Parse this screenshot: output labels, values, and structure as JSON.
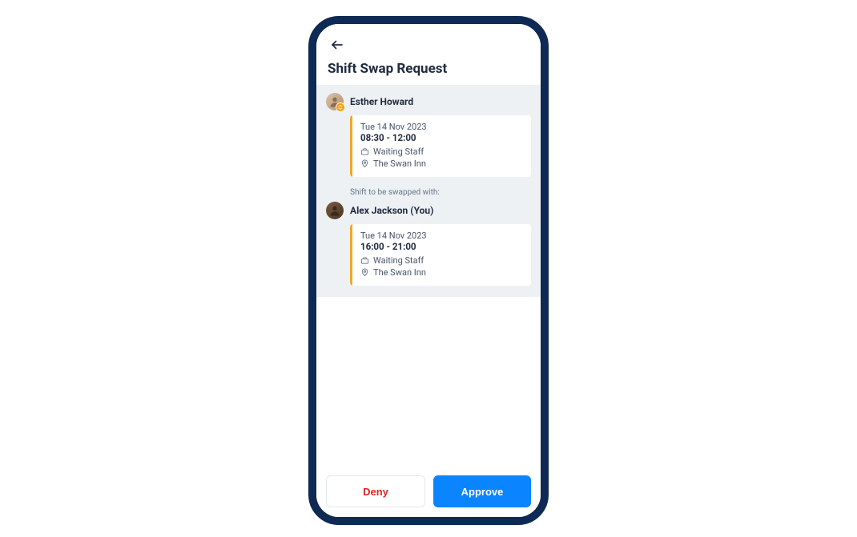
{
  "header": {
    "title": "Shift Swap Request"
  },
  "requester": {
    "name": "Esther Howard",
    "shift": {
      "date": "Tue 14 Nov 2023",
      "time": "08:30 - 12:00",
      "role": "Waiting Staff",
      "location": "The Swan Inn"
    }
  },
  "swap_label": "Shift to be swapped with:",
  "target": {
    "name": "Alex Jackson (You)",
    "shift": {
      "date": "Tue 14 Nov 2023",
      "time": "16:00 - 21:00",
      "role": "Waiting Staff",
      "location": "The Swan Inn"
    }
  },
  "actions": {
    "deny": "Deny",
    "approve": "Approve"
  }
}
